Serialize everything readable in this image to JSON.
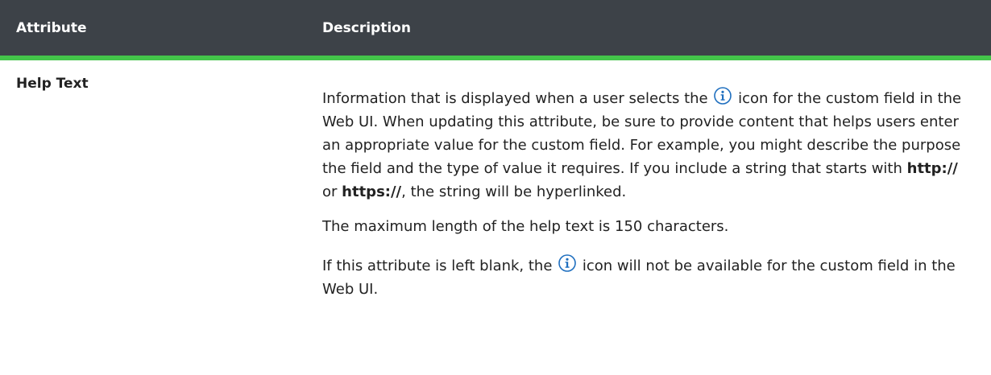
{
  "header": {
    "attribute_label": "Attribute",
    "description_label": "Description"
  },
  "colors": {
    "header_bg": "#3d4248",
    "header_accent": "#44c54a",
    "icon_blue": "#1f6fbf"
  },
  "row": {
    "attribute": "Help Text",
    "para1": {
      "t1": "Information that is displayed when a user selects the",
      "t2": "icon for the custom field in the Web UI. When updating this attribute, be sure to provide content that helps users enter an appropriate value for the custom field. For example, you might describe the purpose the field and the type of value it requires. If you include a string that starts with",
      "bold1": "http://",
      "t3": "or",
      "bold2": "https://",
      "t4": ", the string will be hyperlinked."
    },
    "para2": "The maximum length of the help text is 150 characters.",
    "para3": {
      "t1": "If this attribute is left blank, the",
      "t2": "icon will not be available for the custom field in the Web UI."
    },
    "icon": "info-icon"
  }
}
